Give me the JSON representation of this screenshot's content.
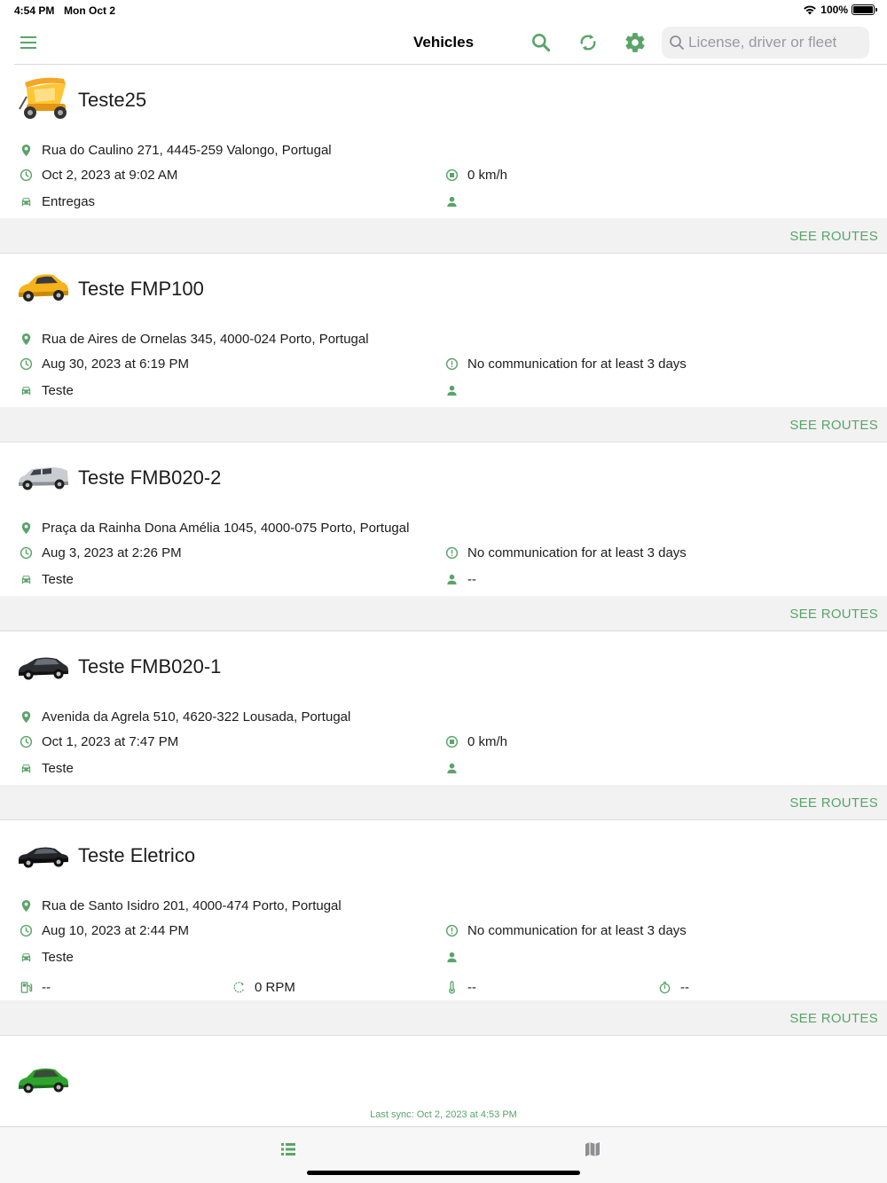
{
  "status_bar": {
    "time": "4:54 PM",
    "date": "Mon Oct 2",
    "battery": "100%"
  },
  "navbar": {
    "title": "Vehicles",
    "search_placeholder": "License, driver or fleet",
    "icons": [
      "menu-icon",
      "search-icon",
      "refresh-icon",
      "gear-icon"
    ]
  },
  "accent_color": "#5aa46a",
  "see_routes_label": "SEE ROUTES",
  "vehicles": [
    {
      "name": "Teste25",
      "vehicle_icon": "tuk-tuk",
      "address": "Rua do Caulino 271, 4445-259 Valongo, Portugal",
      "datetime": "Oct 2, 2023 at 9:02 AM",
      "status_icon": "stopped-icon",
      "status": "0 km/h",
      "fleet": "Entregas",
      "driver": ""
    },
    {
      "name": "Teste FMP100",
      "vehicle_icon": "yellow-car",
      "address": "Rua de Aires de Ornelas 345, 4000-024 Porto, Portugal",
      "datetime": "Aug 30, 2023 at 6:19 PM",
      "status_icon": "alert-icon",
      "status": "No communication for at least 3 days",
      "fleet": "Teste",
      "driver": ""
    },
    {
      "name": "Teste FMB020-2",
      "vehicle_icon": "silver-van",
      "address": "Praça da Rainha Dona Amélia 1045, 4000-075 Porto, Portugal",
      "datetime": "Aug 3, 2023 at 2:26 PM",
      "status_icon": "alert-icon",
      "status": "No communication for at least 3 days",
      "fleet": "Teste",
      "driver": "--"
    },
    {
      "name": "Teste FMB020-1",
      "vehicle_icon": "black-car",
      "address": "Avenida da Agrela 510, 4620-322 Lousada, Portugal",
      "datetime": "Oct 1, 2023 at 7:47 PM",
      "status_icon": "stopped-icon",
      "status": "0 km/h",
      "fleet": "Teste",
      "driver": ""
    },
    {
      "name": "Teste Eletrico",
      "vehicle_icon": "black-sedan",
      "address": "Rua de Santo Isidro 201, 4000-474 Porto, Portugal",
      "datetime": "Aug 10, 2023 at 2:44 PM",
      "status_icon": "alert-icon",
      "status": "No communication for at least 3 days",
      "fleet": "Teste",
      "driver": "",
      "fuel": "--",
      "rpm": "0 RPM",
      "temperature": "--",
      "timer": "--"
    }
  ],
  "partial_vehicle": {
    "vehicle_icon": "green-car"
  },
  "last_sync": "Last sync:  Oct 2, 2023 at 4:53 PM",
  "tabbar": {
    "tabs": [
      "list-icon",
      "map-icon"
    ]
  }
}
